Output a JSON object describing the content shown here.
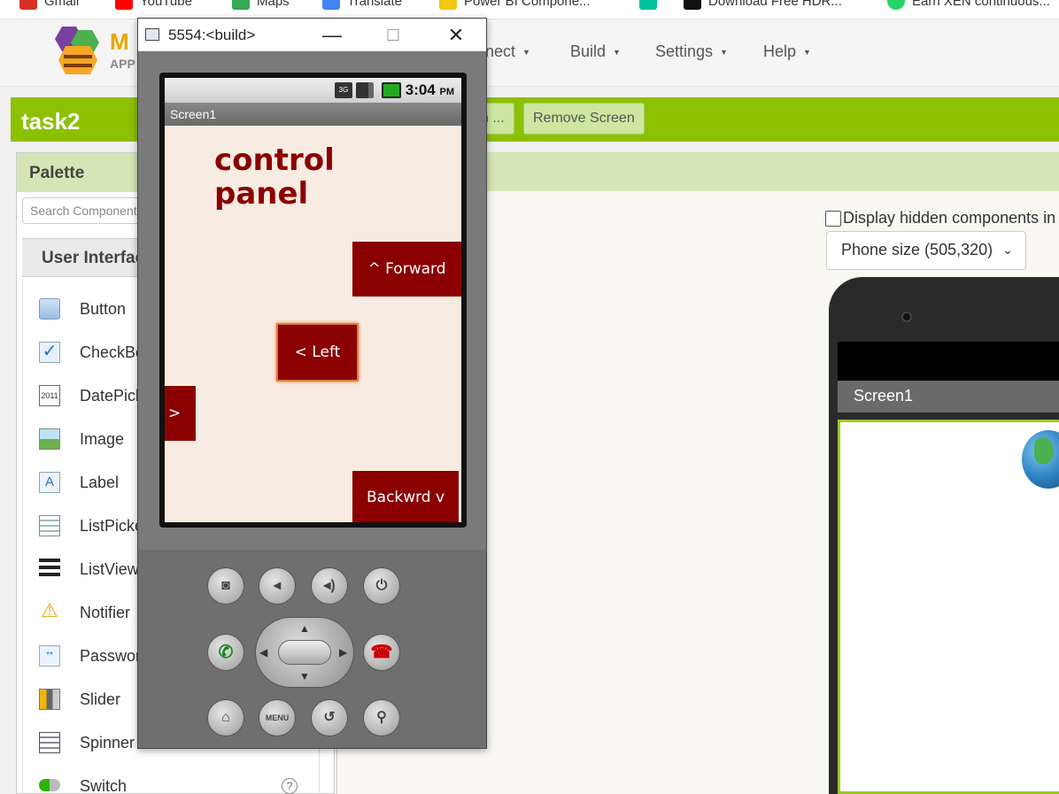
{
  "bookmarks": [
    {
      "label": "Gmail",
      "color": "#d93025"
    },
    {
      "label": "YouTube",
      "color": "#ff0000"
    },
    {
      "label": "Maps",
      "color": "#34a853"
    },
    {
      "label": "Translate",
      "color": "#4285f4"
    },
    {
      "label": "Power BI Compone...",
      "color": "#f2c811"
    },
    {
      "label": "",
      "color": "#00c4a0"
    },
    {
      "label": "Download Free HDR...",
      "color": "#111111"
    },
    {
      "label": "Earn XEN continuous...",
      "color": "#25d366"
    }
  ],
  "topnav": {
    "logo_text": "M",
    "logo_sub": "APP",
    "connect": "nect",
    "build": "Build",
    "settings": "Settings",
    "help": "Help"
  },
  "project": {
    "title": "task2",
    "add_screen": "n ...",
    "remove_screen": "Remove Screen"
  },
  "palette": {
    "title": "Palette",
    "search_placeholder": "Search Components...",
    "category": "User Interface",
    "items": [
      {
        "label": "Button",
        "icon": "button-icon"
      },
      {
        "label": "CheckBox",
        "icon": "checkbox-icon"
      },
      {
        "label": "DatePicker",
        "icon": "datepicker-icon"
      },
      {
        "label": "Image",
        "icon": "image-icon"
      },
      {
        "label": "Label",
        "icon": "label-icon"
      },
      {
        "label": "ListPicker",
        "icon": "listpicker-icon"
      },
      {
        "label": "ListView",
        "icon": "listview-icon"
      },
      {
        "label": "Notifier",
        "icon": "notifier-icon"
      },
      {
        "label": "PasswordTextBox",
        "icon": "password-icon"
      },
      {
        "label": "Slider",
        "icon": "slider-icon"
      },
      {
        "label": "Spinner",
        "icon": "spinner-icon"
      },
      {
        "label": "Switch",
        "icon": "switch-icon"
      }
    ],
    "help_glyph": "?"
  },
  "viewer": {
    "hidden_components": "Display hidden components in Viewer",
    "phone_size": "Phone size (505,320)",
    "screen_title": "Screen1"
  },
  "emulator": {
    "window_title": "5554:<build>",
    "minimize": "—",
    "maximize": "☐",
    "close": "✕",
    "time": "3:04",
    "ampm": "PM",
    "net": "3G",
    "screen_title": "Screen1",
    "label_text": "control panel",
    "btn_forward": "^ Forward",
    "btn_left": "< Left",
    "btn_right": ">",
    "btn_backward": "Backwrd v",
    "menu": "MENU"
  },
  "colors": {
    "accent_green": "#8dc000",
    "button_red": "#8b0000",
    "app_bg": "#f8ece2"
  }
}
